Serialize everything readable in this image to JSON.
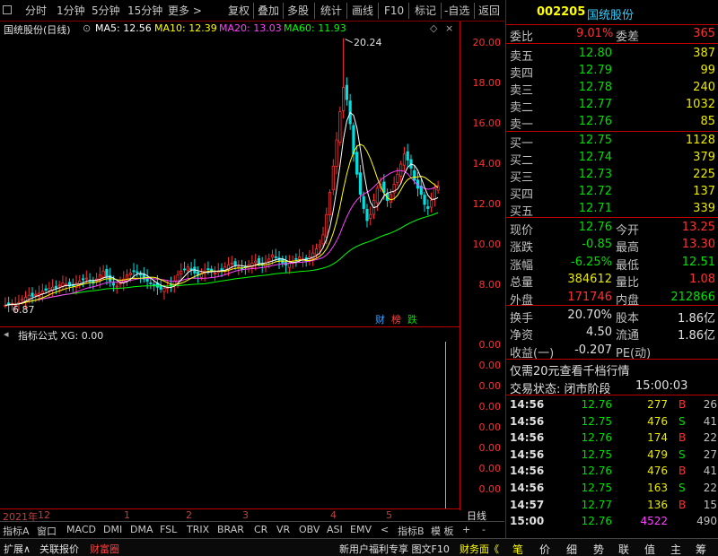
{
  "toolbar": {
    "left_items": [
      "分时",
      "1分钟",
      "5分钟",
      "15分钟",
      "更多 >"
    ],
    "right_items": [
      "复权",
      "叠加",
      "多股",
      "统计",
      "画线",
      "F10",
      "标记",
      "-自选",
      "返回"
    ]
  },
  "chart_header": {
    "stock_label": "国统股份(日线)",
    "ma5": "MA5: 12.56",
    "ma10": "MA10: 12.39",
    "ma20": "MA20: 13.03",
    "ma60": "MA60: 11.93",
    "ma_colors": {
      "ma5": "#ffffff",
      "ma10": "#ffff00",
      "ma20": "#ff40ff",
      "ma60": "#00ff00"
    }
  },
  "chart_data": {
    "type": "candlestick",
    "ylim": [
      6.5,
      20.5
    ],
    "y_ticks": [
      "20.00",
      "18.00",
      "16.00",
      "14.00",
      "12.00",
      "10.00",
      "8.00"
    ],
    "max_label": "20.24",
    "min_label": "6.87",
    "x_ticks": [
      "2021年",
      "12",
      "1",
      "2",
      "3",
      "4",
      "5"
    ],
    "badges": [
      "财",
      "榜",
      "跌"
    ],
    "close": [
      7.0,
      7.05,
      7.1,
      7.05,
      7.15,
      7.3,
      7.4,
      7.5,
      7.45,
      7.55,
      7.6,
      7.7,
      7.75,
      7.85,
      7.9,
      7.85,
      8.0,
      8.1,
      8.05,
      7.95,
      8.0,
      8.1,
      8.2,
      8.3,
      8.35,
      8.2,
      8.1,
      8.3,
      8.5,
      8.7,
      8.4,
      8.2,
      8.0,
      7.95,
      8.1,
      8.3,
      8.5,
      8.6,
      8.7,
      8.65,
      8.5,
      8.3,
      8.2,
      8.1,
      8.0,
      7.9,
      7.8,
      7.85,
      7.9,
      8.0,
      8.2,
      8.5,
      8.7,
      8.8,
      8.9,
      8.8,
      8.6,
      8.5,
      8.6,
      8.7,
      8.8,
      8.7,
      8.6,
      8.7,
      8.8,
      8.9,
      9.0,
      9.1,
      9.0,
      8.9,
      8.8,
      8.9,
      9.0,
      9.1,
      9.2,
      9.1,
      9.0,
      9.1,
      9.3,
      9.5,
      9.4,
      9.2,
      9.1,
      9.0,
      9.1,
      9.2,
      9.3,
      9.4,
      9.3,
      9.2,
      9.4,
      9.6,
      9.8,
      10.0,
      10.5,
      11.5,
      12.6,
      13.9,
      15.2,
      16.6,
      17.8,
      17.2,
      16.0,
      14.5,
      13.5,
      12.5,
      11.8,
      11.2,
      11.5,
      12.2,
      12.8,
      13.0,
      12.6,
      12.2,
      12.5,
      13.0,
      13.5,
      14.0,
      14.5,
      14.2,
      13.8,
      13.2,
      12.8,
      12.5,
      12.0,
      11.8,
      12.2,
      12.8,
      12.9
    ],
    "series_names": [
      "MA5",
      "MA10",
      "MA20",
      "MA60"
    ]
  },
  "indicator": {
    "label": "指标公式  XG: 0.00",
    "y_ticks": [
      "0.00",
      "0.00",
      "0.00",
      "0.00",
      "0.00",
      "0.00",
      "0.00",
      "0.00"
    ]
  },
  "bottom_tabs": [
    "指标A",
    "窗口",
    "MACD",
    "DMI",
    "DMA",
    "FSL",
    "TRIX",
    "BRAR",
    "CR",
    "VR",
    "OBV",
    "ASI",
    "EMV",
    "<",
    "指标B",
    "模 板",
    "+",
    "-",
    "日线"
  ],
  "status_bar": {
    "left": [
      "扩展∧",
      "关联报价",
      "财富圈"
    ],
    "center": "新用户福利专享 图文F10 ",
    "right_link": "财务面《",
    "right_tabs": [
      "笔",
      "价",
      "细",
      "势",
      "联",
      "值",
      "主",
      "筹"
    ]
  },
  "quote": {
    "code": "002205",
    "name": "国统股份",
    "weibi_label": "委比",
    "weibi": "9.01%",
    "weicha_label": "委差",
    "weicha": "365",
    "sell": [
      {
        "label": "卖五",
        "price": "12.80",
        "vol": "387"
      },
      {
        "label": "卖四",
        "price": "12.79",
        "vol": "99"
      },
      {
        "label": "卖三",
        "price": "12.78",
        "vol": "240"
      },
      {
        "label": "卖二",
        "price": "12.77",
        "vol": "1032"
      },
      {
        "label": "卖一",
        "price": "12.76",
        "vol": "85"
      }
    ],
    "buy": [
      {
        "label": "买一",
        "price": "12.75",
        "vol": "1128"
      },
      {
        "label": "买二",
        "price": "12.74",
        "vol": "379"
      },
      {
        "label": "买三",
        "price": "12.73",
        "vol": "225"
      },
      {
        "label": "买四",
        "price": "12.72",
        "vol": "137"
      },
      {
        "label": "买五",
        "price": "12.71",
        "vol": "339"
      }
    ],
    "stats": [
      {
        "l1": "现价",
        "v1": "12.76",
        "l2": "今开",
        "v2": "13.25",
        "c1": "green",
        "c2": "red"
      },
      {
        "l1": "涨跌",
        "v1": "-0.85",
        "l2": "最高",
        "v2": "13.30",
        "c1": "green",
        "c2": "red"
      },
      {
        "l1": "涨幅",
        "v1": "-6.25%",
        "l2": "最低",
        "v2": "12.51",
        "c1": "green",
        "c2": "green"
      },
      {
        "l1": "总量",
        "v1": "384612",
        "l2": "量比",
        "v2": "1.08",
        "c1": "yellow",
        "c2": "red"
      },
      {
        "l1": "外盘",
        "v1": "171746",
        "l2": "内盘",
        "v2": "212866",
        "c1": "red",
        "c2": "green"
      }
    ],
    "stats2": [
      {
        "l1": "换手",
        "v1": "20.70%",
        "l2": "股本",
        "v2": "1.86亿"
      },
      {
        "l1": "净资",
        "v1": "4.50",
        "l2": "流通",
        "v2": "1.86亿"
      },
      {
        "l1": "收益(一)",
        "v1": "-0.207",
        "l2": "PE(动)",
        "v2": ""
      }
    ],
    "promo": "仅需20元查看千档行情",
    "trade_status_label": "交易状态: 闭市阶段",
    "trade_status_time": "15:00:03",
    "ticks": [
      {
        "time": "14:56",
        "price": "12.76",
        "vol": "277",
        "bs": "B",
        "n": "26"
      },
      {
        "time": "14:56",
        "price": "12.75",
        "vol": "476",
        "bs": "S",
        "n": "41"
      },
      {
        "time": "14:56",
        "price": "12.76",
        "vol": "174",
        "bs": "B",
        "n": "22"
      },
      {
        "time": "14:56",
        "price": "12.75",
        "vol": "479",
        "bs": "S",
        "n": "27"
      },
      {
        "time": "14:56",
        "price": "12.76",
        "vol": "476",
        "bs": "B",
        "n": "41"
      },
      {
        "time": "14:56",
        "price": "12.75",
        "vol": "163",
        "bs": "S",
        "n": "22"
      },
      {
        "time": "14:57",
        "price": "12.77",
        "vol": "136",
        "bs": "B",
        "n": "15"
      },
      {
        "time": "15:00",
        "price": "12.76",
        "vol": "4522",
        "bs": "",
        "n": "490"
      }
    ]
  }
}
